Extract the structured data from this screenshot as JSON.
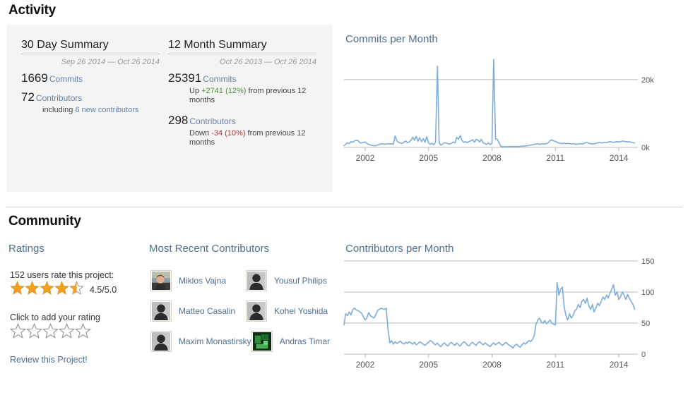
{
  "activity": {
    "section_title": "Activity",
    "summary_30day": {
      "heading": "30 Day Summary",
      "range": "Sep 26 2014 — Oct 26 2014",
      "commits_value": "1669",
      "commits_label": "Commits",
      "contributors_value": "72",
      "contributors_label": "Contributors",
      "including_prefix": "including ",
      "including_link": "6 new contributors"
    },
    "summary_12month": {
      "heading": "12 Month Summary",
      "range": "Oct 26 2013 — Oct 26 2014",
      "commits_value": "25391",
      "commits_label": "Commits",
      "commits_delta_prefix": "Up ",
      "commits_delta": "+2741 (12%)",
      "commits_delta_suffix": " from previous 12 months",
      "contributors_value": "298",
      "contributors_label": "Contributors",
      "contributors_delta_prefix": "Down ",
      "contributors_delta": "-34 (10%)",
      "contributors_delta_suffix": " from previous 12 months"
    }
  },
  "community": {
    "section_title": "Community",
    "ratings": {
      "heading": "Ratings",
      "rate_count_text": "152 users rate this project:",
      "score_text": "4.5/5.0",
      "filled_stars": 4,
      "half_star": true,
      "total_stars": 5,
      "add_rating_label": "Click to add your rating",
      "empty_stars": 5,
      "review_link": "Review this Project!"
    },
    "contributors": {
      "heading": "Most Recent Contributors",
      "people": [
        {
          "name": "Miklos Vajna",
          "avatar": "photo-person"
        },
        {
          "name": "Yousuf Philips",
          "avatar": "silhouette"
        },
        {
          "name": "Matteo Casalin",
          "avatar": "silhouette"
        },
        {
          "name": "Kohei Yoshida",
          "avatar": "silhouette"
        },
        {
          "name": "Maxim Monastirsky",
          "avatar": "silhouette"
        },
        {
          "name": "Andras Timar",
          "avatar": "photo-green"
        }
      ]
    }
  },
  "colors": {
    "line": "#7cadde",
    "star_filled": "#f2a01e",
    "star_empty": "#ffffff",
    "star_stroke": "#9a9a9a",
    "link": "#4d6f92",
    "delta_up": "#4f8a3d",
    "delta_down": "#b03a36",
    "panel_bg": "#f4f4f4",
    "gridline": "#b8b8b8"
  },
  "chart_data": [
    {
      "type": "line",
      "id": "commits-per-month",
      "title": "Commits per Month",
      "xlabel": "",
      "ylabel": "",
      "xlim": [
        2001.0,
        2014.9
      ],
      "ylim": [
        0,
        26000
      ],
      "grid": true,
      "legend": "none",
      "yticks": [
        0,
        20000
      ],
      "ytick_labels": [
        "0k",
        "20k"
      ],
      "xticks": [
        2002,
        2005,
        2008,
        2011,
        2014
      ],
      "xtick_labels": [
        "2002",
        "2005",
        "2008",
        "2011",
        "2014"
      ],
      "x": [
        2001.0,
        2001.08,
        2001.17,
        2001.25,
        2001.33,
        2001.42,
        2001.5,
        2001.58,
        2001.67,
        2001.75,
        2001.83,
        2001.92,
        2002.0,
        2002.08,
        2002.17,
        2002.25,
        2002.33,
        2002.42,
        2002.5,
        2002.58,
        2002.67,
        2002.75,
        2002.83,
        2002.92,
        2003.0,
        2003.08,
        2003.17,
        2003.25,
        2003.33,
        2003.42,
        2003.5,
        2003.58,
        2003.67,
        2003.75,
        2003.83,
        2003.92,
        2004.0,
        2004.08,
        2004.17,
        2004.25,
        2004.33,
        2004.42,
        2004.5,
        2004.58,
        2004.67,
        2004.75,
        2004.83,
        2004.92,
        2005.0,
        2005.08,
        2005.17,
        2005.25,
        2005.33,
        2005.42,
        2005.5,
        2005.58,
        2005.67,
        2005.75,
        2005.83,
        2005.92,
        2006.0,
        2006.08,
        2006.17,
        2006.25,
        2006.33,
        2006.42,
        2006.5,
        2006.58,
        2006.67,
        2006.75,
        2006.83,
        2006.92,
        2007.0,
        2007.08,
        2007.17,
        2007.25,
        2007.33,
        2007.42,
        2007.5,
        2007.58,
        2007.67,
        2007.75,
        2007.83,
        2007.92,
        2008.0,
        2008.08,
        2008.17,
        2008.25,
        2008.33,
        2008.42,
        2008.5,
        2008.58,
        2008.67,
        2008.75,
        2008.83,
        2008.92,
        2009.0,
        2009.08,
        2009.17,
        2009.25,
        2009.33,
        2009.42,
        2009.5,
        2009.58,
        2009.67,
        2009.75,
        2009.83,
        2009.92,
        2010.0,
        2010.08,
        2010.17,
        2010.25,
        2010.33,
        2010.42,
        2010.5,
        2010.58,
        2010.67,
        2010.75,
        2010.83,
        2010.92,
        2011.0,
        2011.08,
        2011.17,
        2011.25,
        2011.33,
        2011.42,
        2011.5,
        2011.58,
        2011.67,
        2011.75,
        2011.83,
        2011.92,
        2012.0,
        2012.08,
        2012.17,
        2012.25,
        2012.33,
        2012.42,
        2012.5,
        2012.58,
        2012.67,
        2012.75,
        2012.83,
        2012.92,
        2013.0,
        2013.08,
        2013.17,
        2013.25,
        2013.33,
        2013.42,
        2013.5,
        2013.58,
        2013.67,
        2013.75,
        2013.83,
        2013.92,
        2014.0,
        2014.08,
        2014.17,
        2014.25,
        2014.33,
        2014.42,
        2014.5,
        2014.58,
        2014.67,
        2014.75
      ],
      "y": [
        500,
        900,
        1400,
        1100,
        1700,
        1500,
        1900,
        2100,
        2000,
        1400,
        1300,
        1500,
        1600,
        1200,
        900,
        700,
        600,
        500,
        500,
        700,
        900,
        1000,
        1100,
        900,
        1000,
        1100,
        1000,
        1100,
        900,
        3400,
        2000,
        1500,
        1300,
        1200,
        1500,
        1900,
        1400,
        1600,
        2100,
        3000,
        2100,
        3300,
        1800,
        2900,
        1700,
        2600,
        1500,
        3200,
        1400,
        900,
        1200,
        800,
        1500,
        24000,
        1400,
        700,
        1000,
        1400,
        1300,
        1100,
        1000,
        1200,
        1600,
        1300,
        3000,
        2400,
        3500,
        2100,
        1500,
        1700,
        1400,
        1800,
        1900,
        2300,
        1500,
        2400,
        2200,
        1600,
        2400,
        1400,
        1100,
        900,
        1400,
        800,
        1300,
        26000,
        2500,
        2400,
        1500,
        300,
        200,
        200,
        250,
        200,
        300,
        250,
        300,
        250,
        300,
        250,
        300,
        350,
        400,
        450,
        500,
        600,
        700,
        800,
        900,
        1000,
        1100,
        900,
        1000,
        1100,
        1000,
        1100,
        1400,
        2000,
        2200,
        1900,
        1800,
        1500,
        1300,
        1200,
        1100,
        1300,
        1100,
        1200,
        1100,
        1000,
        1100,
        1000,
        900,
        1000,
        1100,
        1000,
        1100,
        1400,
        1500,
        1200,
        1100,
        1000,
        1100,
        1200,
        1400,
        1500,
        1300,
        1400,
        1500,
        1400,
        1600,
        1700,
        1600,
        1500,
        1600,
        1700,
        1600,
        1700,
        1900,
        1800,
        1700,
        1600,
        1700,
        1500,
        1400,
        1300
      ]
    },
    {
      "type": "line",
      "id": "contributors-per-month",
      "title": "Contributors per Month",
      "xlabel": "",
      "ylabel": "",
      "xlim": [
        2001.0,
        2014.9
      ],
      "ylim": [
        0,
        150
      ],
      "grid": true,
      "legend": "none",
      "yticks": [
        0,
        50,
        100,
        150
      ],
      "ytick_labels": [
        "0",
        "50",
        "100",
        "150"
      ],
      "xticks": [
        2002,
        2005,
        2008,
        2011,
        2014
      ],
      "xtick_labels": [
        "2002",
        "2005",
        "2008",
        "2011",
        "2014"
      ],
      "x": [
        2001.0,
        2001.08,
        2001.17,
        2001.25,
        2001.33,
        2001.42,
        2001.5,
        2001.58,
        2001.67,
        2001.75,
        2001.83,
        2001.92,
        2002.0,
        2002.08,
        2002.17,
        2002.25,
        2002.33,
        2002.42,
        2002.5,
        2002.58,
        2002.67,
        2002.75,
        2002.83,
        2002.92,
        2003.0,
        2003.08,
        2003.17,
        2003.25,
        2003.33,
        2003.42,
        2003.5,
        2003.58,
        2003.67,
        2003.75,
        2003.83,
        2003.92,
        2004.0,
        2004.08,
        2004.17,
        2004.25,
        2004.33,
        2004.42,
        2004.5,
        2004.58,
        2004.67,
        2004.75,
        2004.83,
        2004.92,
        2005.0,
        2005.08,
        2005.17,
        2005.25,
        2005.33,
        2005.42,
        2005.5,
        2005.58,
        2005.67,
        2005.75,
        2005.83,
        2005.92,
        2006.0,
        2006.08,
        2006.17,
        2006.25,
        2006.33,
        2006.42,
        2006.5,
        2006.58,
        2006.67,
        2006.75,
        2006.83,
        2006.92,
        2007.0,
        2007.08,
        2007.17,
        2007.25,
        2007.33,
        2007.42,
        2007.5,
        2007.58,
        2007.67,
        2007.75,
        2007.83,
        2007.92,
        2008.0,
        2008.08,
        2008.17,
        2008.25,
        2008.33,
        2008.42,
        2008.5,
        2008.58,
        2008.67,
        2008.75,
        2008.83,
        2008.92,
        2009.0,
        2009.08,
        2009.17,
        2009.25,
        2009.33,
        2009.42,
        2009.5,
        2009.58,
        2009.67,
        2009.75,
        2009.83,
        2009.92,
        2010.0,
        2010.08,
        2010.17,
        2010.25,
        2010.33,
        2010.42,
        2010.5,
        2010.58,
        2010.67,
        2010.75,
        2010.83,
        2010.92,
        2011.0,
        2011.08,
        2011.17,
        2011.25,
        2011.33,
        2011.42,
        2011.5,
        2011.58,
        2011.67,
        2011.75,
        2011.83,
        2011.92,
        2012.0,
        2012.08,
        2012.17,
        2012.25,
        2012.33,
        2012.42,
        2012.5,
        2012.58,
        2012.67,
        2012.75,
        2012.83,
        2012.92,
        2013.0,
        2013.08,
        2013.17,
        2013.25,
        2013.33,
        2013.42,
        2013.5,
        2013.58,
        2013.67,
        2013.75,
        2013.83,
        2013.92,
        2014.0,
        2014.08,
        2014.17,
        2014.25,
        2014.33,
        2014.42,
        2014.5,
        2014.58,
        2014.67,
        2014.75
      ],
      "y": [
        47,
        65,
        62,
        68,
        63,
        72,
        74,
        71,
        70,
        68,
        66,
        60,
        55,
        58,
        67,
        62,
        60,
        58,
        63,
        70,
        72,
        74,
        73,
        72,
        74,
        40,
        18,
        22,
        16,
        20,
        17,
        19,
        21,
        18,
        16,
        19,
        17,
        20,
        18,
        16,
        19,
        15,
        17,
        20,
        18,
        16,
        14,
        17,
        19,
        22,
        20,
        17,
        15,
        18,
        14,
        12,
        16,
        18,
        15,
        13,
        17,
        19,
        16,
        14,
        18,
        15,
        13,
        17,
        20,
        18,
        15,
        13,
        17,
        19,
        16,
        14,
        18,
        20,
        17,
        15,
        18,
        16,
        14,
        12,
        16,
        18,
        15,
        17,
        19,
        16,
        14,
        17,
        19,
        16,
        14,
        12,
        10,
        14,
        16,
        13,
        11,
        15,
        18,
        16,
        19,
        22,
        20,
        24,
        30,
        48,
        55,
        58,
        52,
        50,
        54,
        49,
        52,
        55,
        50,
        48,
        47,
        115,
        95,
        105,
        108,
        75,
        62,
        55,
        65,
        58,
        62,
        70,
        72,
        80,
        75,
        85,
        88,
        82,
        90,
        78,
        72,
        80,
        68,
        75,
        82,
        78,
        85,
        92,
        88,
        95,
        90,
        98,
        105,
        112,
        95,
        100,
        88,
        92,
        100,
        95,
        88,
        96,
        90,
        85,
        80,
        72
      ]
    }
  ]
}
